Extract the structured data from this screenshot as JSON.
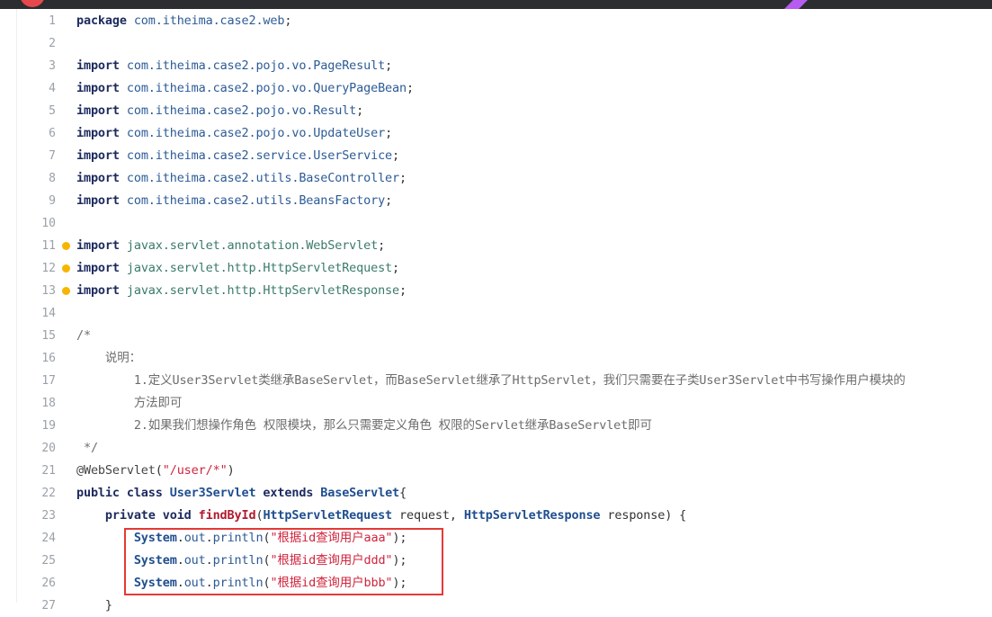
{
  "lines": [
    {
      "n": "1",
      "segs": [
        {
          "t": "package ",
          "c": "k"
        },
        {
          "t": "com.itheima.case2.web",
          "c": "p"
        },
        {
          "t": ";",
          "c": ""
        }
      ]
    },
    {
      "n": "2",
      "segs": []
    },
    {
      "n": "3",
      "segs": [
        {
          "t": "import ",
          "c": "k"
        },
        {
          "t": "com.itheima.case2.pojo.vo.PageResult",
          "c": "p"
        },
        {
          "t": ";",
          "c": ""
        }
      ]
    },
    {
      "n": "4",
      "segs": [
        {
          "t": "import ",
          "c": "k"
        },
        {
          "t": "com.itheima.case2.pojo.vo.QueryPageBean",
          "c": "p"
        },
        {
          "t": ";",
          "c": ""
        }
      ]
    },
    {
      "n": "5",
      "segs": [
        {
          "t": "import ",
          "c": "k"
        },
        {
          "t": "com.itheima.case2.pojo.vo.Result",
          "c": "p"
        },
        {
          "t": ";",
          "c": ""
        }
      ]
    },
    {
      "n": "6",
      "segs": [
        {
          "t": "import ",
          "c": "k"
        },
        {
          "t": "com.itheima.case2.pojo.vo.UpdateUser",
          "c": "p"
        },
        {
          "t": ";",
          "c": ""
        }
      ]
    },
    {
      "n": "7",
      "segs": [
        {
          "t": "import ",
          "c": "k"
        },
        {
          "t": "com.itheima.case2.service.UserService",
          "c": "p"
        },
        {
          "t": ";",
          "c": ""
        }
      ]
    },
    {
      "n": "8",
      "segs": [
        {
          "t": "import ",
          "c": "k"
        },
        {
          "t": "com.itheima.case2.utils.BaseController",
          "c": "p"
        },
        {
          "t": ";",
          "c": ""
        }
      ]
    },
    {
      "n": "9",
      "segs": [
        {
          "t": "import ",
          "c": "k"
        },
        {
          "t": "com.itheima.case2.utils.BeansFactory",
          "c": "p"
        },
        {
          "t": ";",
          "c": ""
        }
      ]
    },
    {
      "n": "10",
      "segs": []
    },
    {
      "n": "11",
      "dot": true,
      "segs": [
        {
          "t": "import ",
          "c": "k"
        },
        {
          "t": "javax.servlet.annotation.WebServlet",
          "c": "jx"
        },
        {
          "t": ";",
          "c": ""
        }
      ]
    },
    {
      "n": "12",
      "dot": true,
      "segs": [
        {
          "t": "import ",
          "c": "k"
        },
        {
          "t": "javax.servlet.http.HttpServletRequest",
          "c": "jx"
        },
        {
          "t": ";",
          "c": ""
        }
      ]
    },
    {
      "n": "13",
      "dot": true,
      "segs": [
        {
          "t": "import ",
          "c": "k"
        },
        {
          "t": "javax.servlet.http.HttpServletResponse",
          "c": "jx"
        },
        {
          "t": ";",
          "c": ""
        }
      ]
    },
    {
      "n": "14",
      "segs": []
    },
    {
      "n": "15",
      "segs": [
        {
          "t": "/*",
          "c": "cm"
        }
      ]
    },
    {
      "n": "16",
      "segs": [
        {
          "t": "    说明：",
          "c": "cm"
        }
      ]
    },
    {
      "n": "17",
      "segs": [
        {
          "t": "        1.定义User3Servlet类继承BaseServlet，而BaseServlet继承了HttpServlet，我们只需要在子类User3Servlet中书写操作用户模块的",
          "c": "cm"
        }
      ]
    },
    {
      "n": "18",
      "segs": [
        {
          "t": "        方法即可",
          "c": "cm"
        }
      ]
    },
    {
      "n": "19",
      "segs": [
        {
          "t": "        2.如果我们想操作角色 权限模块，那么只需要定义角色 权限的Servlet继承BaseServlet即可",
          "c": "cm"
        }
      ]
    },
    {
      "n": "20",
      "segs": [
        {
          "t": " */",
          "c": "cm"
        }
      ]
    },
    {
      "n": "21",
      "segs": [
        {
          "t": "@WebServlet",
          "c": "an"
        },
        {
          "t": "(",
          "c": ""
        },
        {
          "t": "\"/user/*\"",
          "c": "st"
        },
        {
          "t": ")",
          "c": ""
        }
      ]
    },
    {
      "n": "22",
      "segs": [
        {
          "t": "public class ",
          "c": "k"
        },
        {
          "t": "User3Servlet",
          "c": "cl"
        },
        {
          "t": " extends ",
          "c": "k"
        },
        {
          "t": "BaseServlet",
          "c": "cl"
        },
        {
          "t": "{",
          "c": ""
        }
      ]
    },
    {
      "n": "23",
      "segs": [
        {
          "t": "    private void ",
          "c": "k"
        },
        {
          "t": "findById",
          "c": "fn"
        },
        {
          "t": "(",
          "c": ""
        },
        {
          "t": "HttpServletRequest",
          "c": "cl"
        },
        {
          "t": " request, ",
          "c": ""
        },
        {
          "t": "HttpServletResponse",
          "c": "cl"
        },
        {
          "t": " response) {",
          "c": ""
        }
      ]
    },
    {
      "n": "24",
      "segs": [
        {
          "t": "        ",
          "c": ""
        },
        {
          "t": "System",
          "c": "cl"
        },
        {
          "t": ".",
          "c": ""
        },
        {
          "t": "out",
          "c": "p"
        },
        {
          "t": ".",
          "c": ""
        },
        {
          "t": "println",
          "c": "p"
        },
        {
          "t": "(",
          "c": ""
        },
        {
          "t": "\"根据id查询用户aaa\"",
          "c": "st"
        },
        {
          "t": ");",
          "c": ""
        }
      ]
    },
    {
      "n": "25",
      "segs": [
        {
          "t": "        ",
          "c": ""
        },
        {
          "t": "System",
          "c": "cl"
        },
        {
          "t": ".",
          "c": ""
        },
        {
          "t": "out",
          "c": "p"
        },
        {
          "t": ".",
          "c": ""
        },
        {
          "t": "println",
          "c": "p"
        },
        {
          "t": "(",
          "c": ""
        },
        {
          "t": "\"根据id查询用户ddd\"",
          "c": "st"
        },
        {
          "t": ");",
          "c": ""
        }
      ]
    },
    {
      "n": "26",
      "segs": [
        {
          "t": "        ",
          "c": ""
        },
        {
          "t": "System",
          "c": "cl"
        },
        {
          "t": ".",
          "c": ""
        },
        {
          "t": "out",
          "c": "p"
        },
        {
          "t": ".",
          "c": ""
        },
        {
          "t": "println",
          "c": "p"
        },
        {
          "t": "(",
          "c": ""
        },
        {
          "t": "\"根据id查询用户bbb\"",
          "c": "st"
        },
        {
          "t": ");",
          "c": ""
        }
      ]
    },
    {
      "n": "27",
      "segs": [
        {
          "t": "    }",
          "c": ""
        }
      ]
    }
  ]
}
